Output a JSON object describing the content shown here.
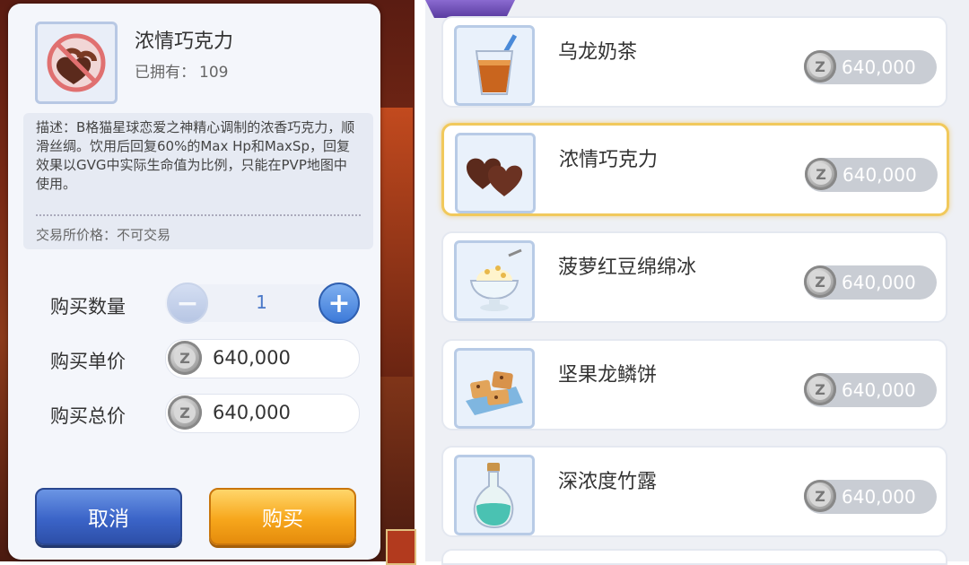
{
  "dialog": {
    "item_name": "浓情巧克力",
    "owned_label": "已拥有：",
    "owned_count": "109",
    "description": "描述：B格猫星球恋爱之神精心调制的浓香巧克力，顺滑丝绸。饮用后回复60%的Max Hp和MaxSp，回复效果以GVG中实际生命值为比例，只能在PVP地图中使用。",
    "trade_price": "交易所价格：不可交易",
    "quantity_label": "购买数量",
    "quantity_value": "1",
    "unit_price_label": "购买单价",
    "unit_price": "640,000",
    "total_price_label": "购买总价",
    "total_price": "640,000",
    "cancel_label": "取消",
    "buy_label": "购买"
  },
  "shop": {
    "items": [
      {
        "name": "乌龙奶茶",
        "price": "640,000",
        "icon": "milk-tea-icon"
      },
      {
        "name": "浓情巧克力",
        "price": "640,000",
        "icon": "chocolate-icon",
        "selected": true
      },
      {
        "name": "菠萝红豆绵绵冰",
        "price": "640,000",
        "icon": "shaved-ice-icon"
      },
      {
        "name": "坚果龙鳞饼",
        "price": "640,000",
        "icon": "cookie-icon"
      },
      {
        "name": "深浓度竹露",
        "price": "640,000",
        "icon": "potion-bottle-icon"
      }
    ]
  },
  "currency_icon": "zeny-coin-icon",
  "colors": {
    "cancel_button": "#3b64c8",
    "buy_button": "#f7a71c",
    "selected_border": "#f1c95c"
  }
}
